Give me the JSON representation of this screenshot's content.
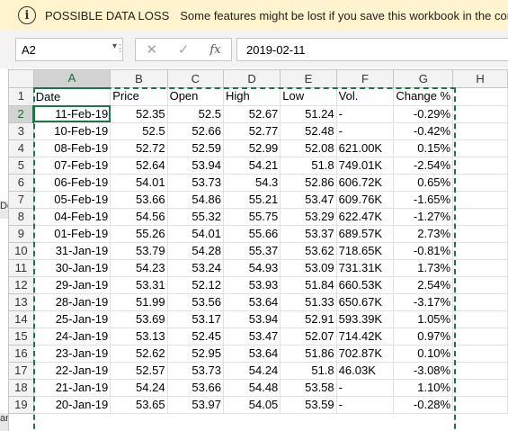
{
  "message_bar": {
    "icon": "info-icon",
    "title": "POSSIBLE DATA LOSS",
    "text": "Some features might be lost if you save this workbook in the comma-deli"
  },
  "formula_bar": {
    "name_box": "A2",
    "formula": "2019-02-11",
    "fx_label": "fx"
  },
  "left_fragments": [
    "Do",
    "an"
  ],
  "columns": [
    "A",
    "B",
    "C",
    "D",
    "E",
    "F",
    "G",
    "H"
  ],
  "rows": [
    [
      "1",
      "Date",
      "Price",
      "Open",
      "High",
      "Low",
      "Vol.",
      "Change %",
      ""
    ],
    [
      "2",
      "11-Feb-19",
      "52.35",
      "52.5",
      "52.67",
      "51.24",
      "-",
      "-0.29%",
      ""
    ],
    [
      "3",
      "10-Feb-19",
      "52.5",
      "52.66",
      "52.77",
      "52.48",
      "-",
      "-0.42%",
      ""
    ],
    [
      "4",
      "08-Feb-19",
      "52.72",
      "52.59",
      "52.99",
      "52.08",
      "621.00K",
      "0.15%",
      ""
    ],
    [
      "5",
      "07-Feb-19",
      "52.64",
      "53.94",
      "54.21",
      "51.8",
      "749.01K",
      "-2.54%",
      ""
    ],
    [
      "6",
      "06-Feb-19",
      "54.01",
      "53.73",
      "54.3",
      "52.86",
      "606.72K",
      "0.65%",
      ""
    ],
    [
      "7",
      "05-Feb-19",
      "53.66",
      "54.86",
      "55.21",
      "53.47",
      "609.76K",
      "-1.65%",
      ""
    ],
    [
      "8",
      "04-Feb-19",
      "54.56",
      "55.32",
      "55.75",
      "53.29",
      "622.47K",
      "-1.27%",
      ""
    ],
    [
      "9",
      "01-Feb-19",
      "55.26",
      "54.01",
      "55.66",
      "53.37",
      "689.57K",
      "2.73%",
      ""
    ],
    [
      "10",
      "31-Jan-19",
      "53.79",
      "54.28",
      "55.37",
      "53.62",
      "718.65K",
      "-0.81%",
      ""
    ],
    [
      "11",
      "30-Jan-19",
      "54.23",
      "53.24",
      "54.93",
      "53.09",
      "731.31K",
      "1.73%",
      ""
    ],
    [
      "12",
      "29-Jan-19",
      "53.31",
      "52.12",
      "53.93",
      "51.84",
      "660.53K",
      "2.54%",
      ""
    ],
    [
      "13",
      "28-Jan-19",
      "51.99",
      "53.56",
      "53.64",
      "51.33",
      "650.67K",
      "-3.17%",
      ""
    ],
    [
      "14",
      "25-Jan-19",
      "53.69",
      "53.17",
      "53.94",
      "52.91",
      "593.39K",
      "1.05%",
      ""
    ],
    [
      "15",
      "24-Jan-19",
      "53.13",
      "52.45",
      "53.47",
      "52.07",
      "714.42K",
      "0.97%",
      ""
    ],
    [
      "16",
      "23-Jan-19",
      "52.62",
      "52.95",
      "53.64",
      "51.86",
      "702.87K",
      "0.10%",
      ""
    ],
    [
      "17",
      "22-Jan-19",
      "52.57",
      "53.73",
      "54.24",
      "51.8",
      "46.03K",
      "-3.08%",
      ""
    ],
    [
      "18",
      "21-Jan-19",
      "54.24",
      "53.66",
      "54.48",
      "53.58",
      "-",
      "1.10%",
      ""
    ],
    [
      "19",
      "20-Jan-19",
      "53.65",
      "53.97",
      "54.05",
      "53.59",
      "-",
      "-0.28%",
      ""
    ]
  ],
  "colors": {
    "accent": "#217346",
    "message_bg": "#fff4ce"
  }
}
